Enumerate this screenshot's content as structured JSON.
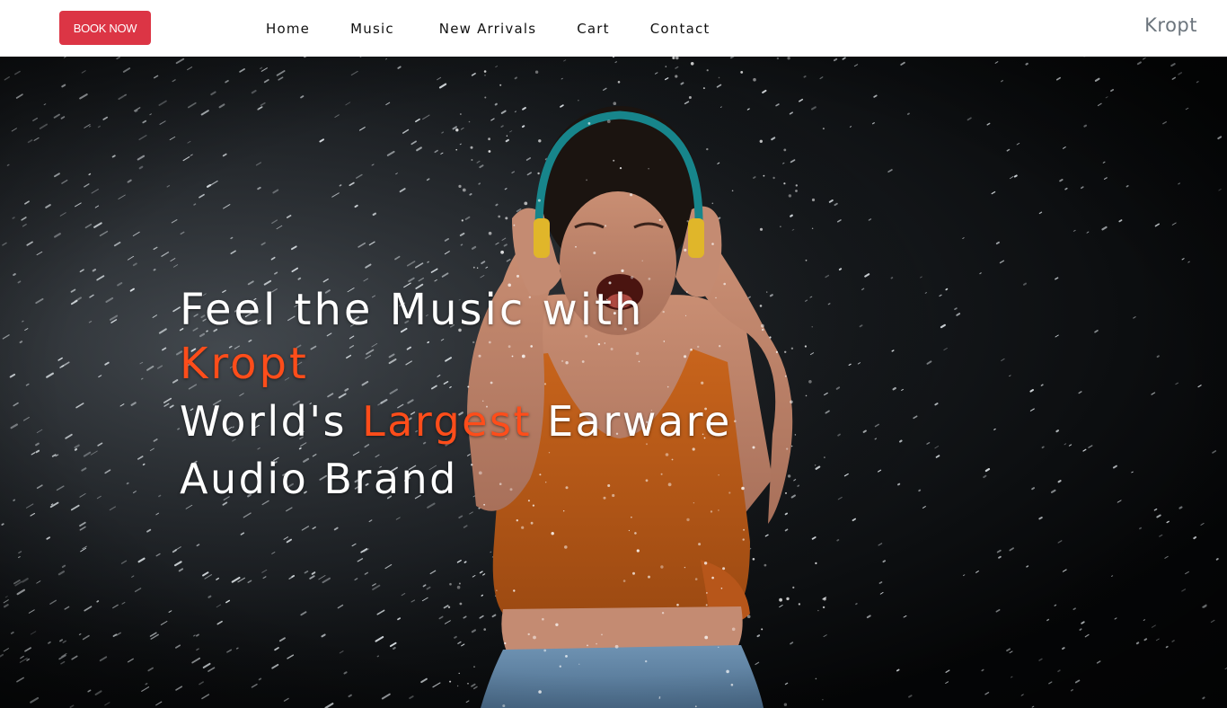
{
  "navbar": {
    "book_button_label": "BOOK NOW",
    "links": [
      "Home",
      "Music",
      "New Arrivals",
      "Cart",
      "Contact"
    ],
    "brand": "Kropt"
  },
  "hero": {
    "headline_line1": "Feel the Music with",
    "headline_brand": "Kropt",
    "tagline_prefix": "World's ",
    "tagline_highlight": "Largest",
    "tagline_suffix": " Earware",
    "tagline_line2": "Audio Brand"
  },
  "colors": {
    "accent": "#ff4d1a",
    "button": "#dc3545",
    "brand_text": "#6c757d",
    "navbar_bg": "#ffffff"
  },
  "icons": [
    "headphones-person-photo"
  ]
}
